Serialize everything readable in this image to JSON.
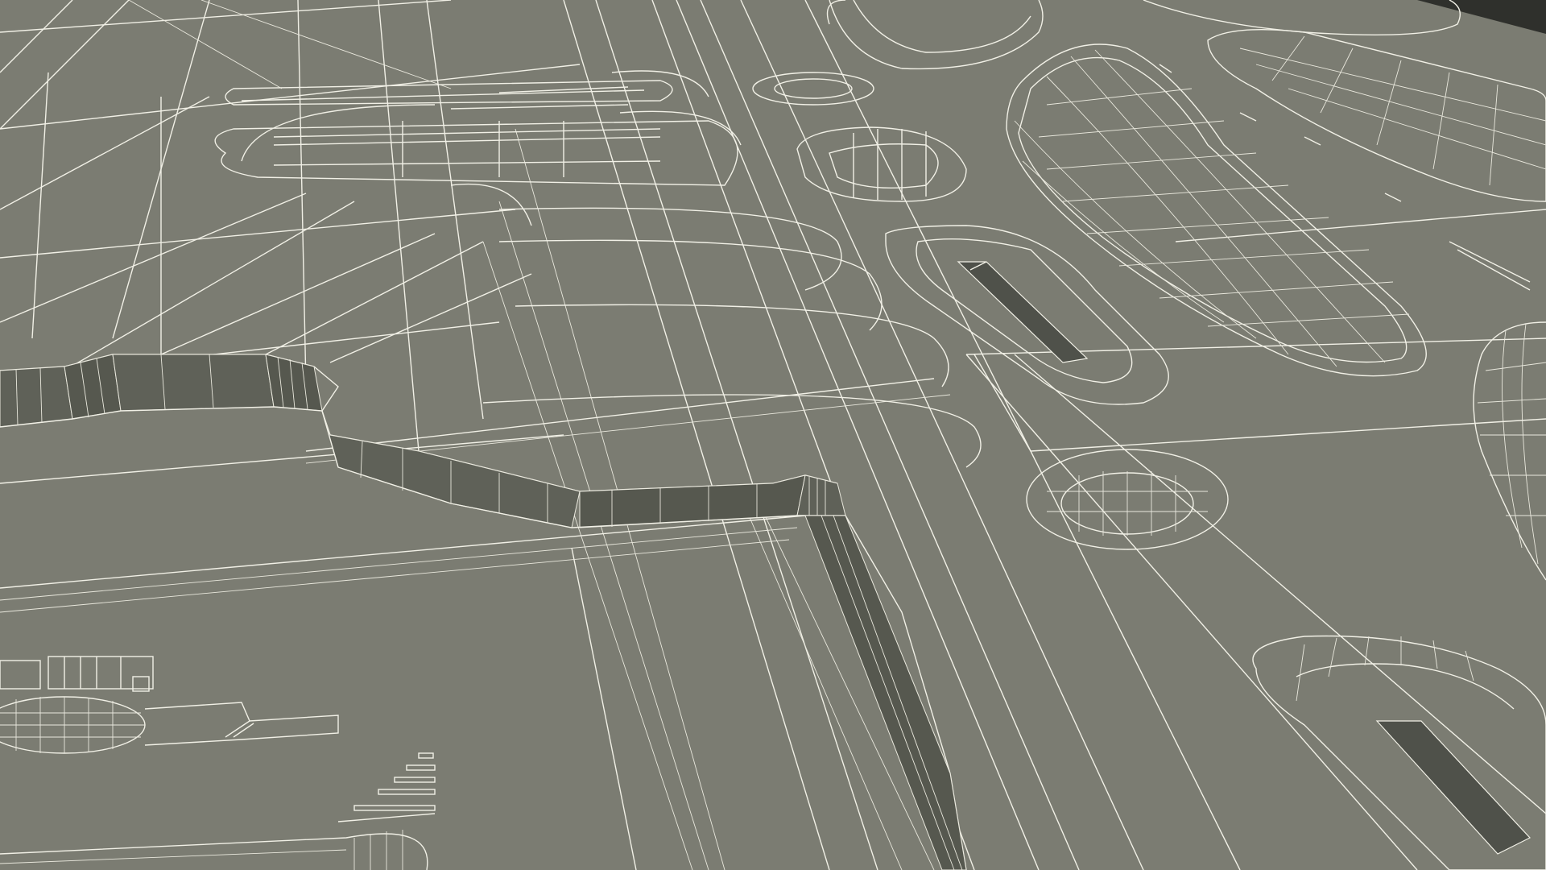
{
  "scene": {
    "subject": "3d-wireframe-panel",
    "colors": {
      "surface": "#7b7c72",
      "wire": "#f1f0e6",
      "wall": "#5f6158",
      "slot": "#4f514a",
      "corner": "#2f302c"
    }
  }
}
